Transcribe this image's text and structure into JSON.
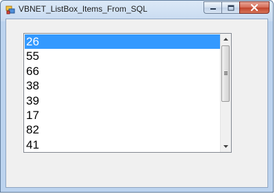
{
  "window": {
    "title": "VBNET_ListBox_Items_From_SQL",
    "icon": "app-window-icon",
    "caption_buttons": [
      "minimize-icon",
      "maximize-icon",
      "close-icon"
    ]
  },
  "listbox": {
    "items": [
      "26",
      "55",
      "66",
      "38",
      "39",
      "17",
      "82",
      "41"
    ],
    "selected_index": 0,
    "selection_color": "#3399ff"
  },
  "scrollbar": {
    "icons": [
      "scroll-up-arrow-icon",
      "scroll-thumb-grip-icon",
      "scroll-down-arrow-icon"
    ]
  }
}
